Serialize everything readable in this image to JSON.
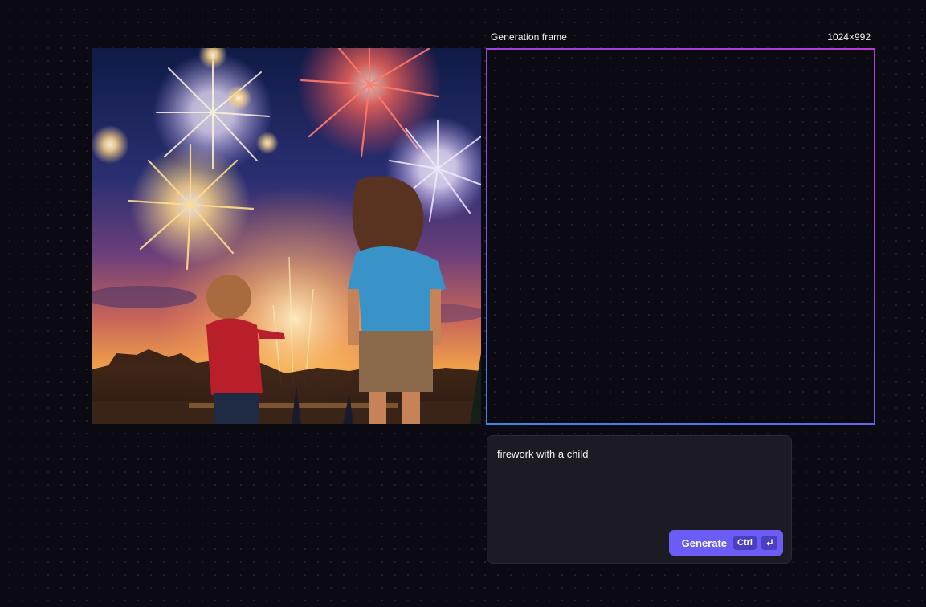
{
  "generation_frame": {
    "label": "Generation frame",
    "size": "1024×992"
  },
  "artwork": {
    "description_icon": "fireworks-children-image"
  },
  "prompt": {
    "value": "firework with a child"
  },
  "generate": {
    "label": "Generate",
    "shortcut_key": "Ctrl",
    "shortcut_icon": "enter-icon"
  },
  "colors": {
    "background": "#0b0a12",
    "accent": "#6b5cf6",
    "frame_gradient_top": "#b83ad6",
    "frame_gradient_bottom": "#3e89e6",
    "panel": "#1c1b23"
  }
}
